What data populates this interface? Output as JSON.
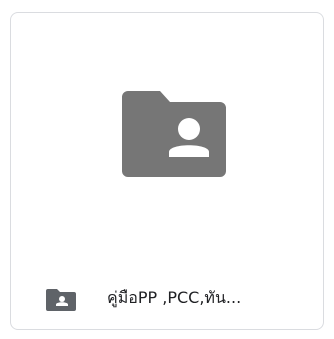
{
  "folder": {
    "name": "คู่มือPP ,PCC,ทัน...",
    "type": "shared-folder",
    "thumbnail_icon": "shared-folder-icon",
    "footer_icon": "shared-folder-icon",
    "icon_color": "#767676"
  }
}
